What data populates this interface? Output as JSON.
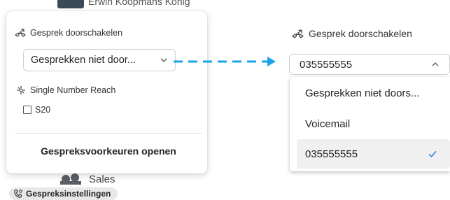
{
  "background": {
    "top_contact_name": "Erwin Koopmans Konig",
    "sales_label": "Sales",
    "chip_label": "Gespreksinstellingen"
  },
  "left_popup": {
    "forward_label": "Gesprek doorschakelen",
    "forward_selected": "Gesprekken niet door...",
    "snr_label": "Single Number Reach",
    "snr_checkbox_label": "S20",
    "snr_checked": false,
    "open_button_label": "Gespreksvoorkeuren openen"
  },
  "right_dropdown": {
    "forward_label": "Gesprek doorschakelen",
    "selected_value": "035555555",
    "options": [
      {
        "label": "Gesprekken niet doors...",
        "selected": false
      },
      {
        "label": "Voicemail",
        "selected": false
      },
      {
        "label": "035555555",
        "selected": true
      }
    ]
  },
  "colors": {
    "arrow": "#1aa3e8",
    "check": "#1a73e8",
    "chip_bg": "#e8e8e8"
  }
}
